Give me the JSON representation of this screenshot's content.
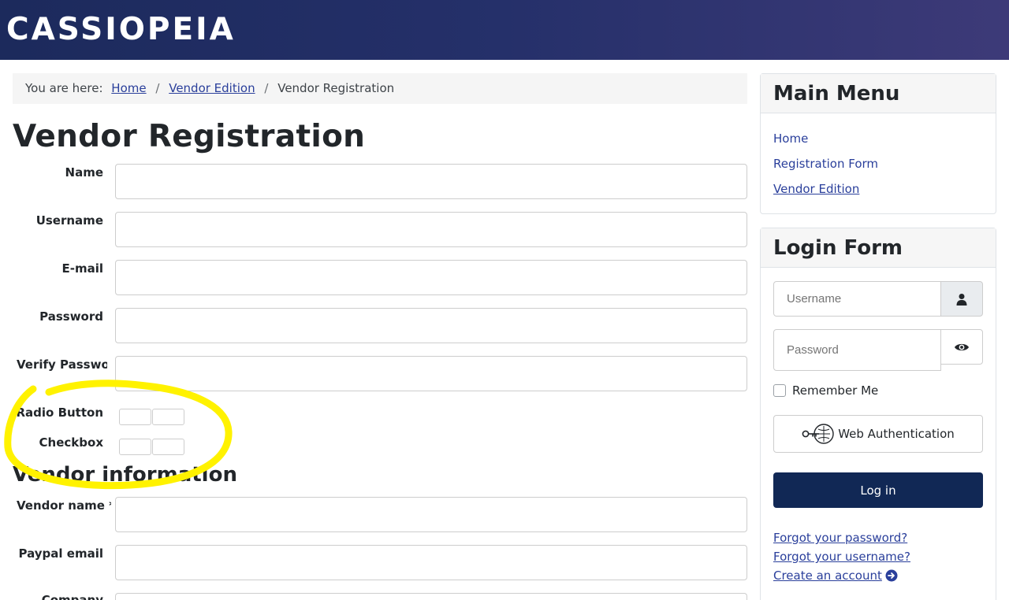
{
  "site": {
    "brand": "CASSIOPEIA"
  },
  "breadcrumb": {
    "prefix": "You are here:",
    "items": [
      "Home",
      "Vendor Edition",
      "Vendor Registration"
    ]
  },
  "page": {
    "title": "Vendor Registration"
  },
  "registration_form": {
    "fields": [
      {
        "label": "Name",
        "value": ""
      },
      {
        "label": "Username",
        "value": ""
      },
      {
        "label": "E-mail",
        "value": ""
      },
      {
        "label": "Password",
        "value": ""
      },
      {
        "label": "Verify Password",
        "value": ""
      }
    ],
    "radio_label": "Radio Button",
    "checkbox_label": "Checkbox"
  },
  "vendor_section": {
    "title": "Vendor information",
    "fields": [
      {
        "label": "Vendor name *.",
        "value": ""
      },
      {
        "label": "Paypal email",
        "value": ""
      },
      {
        "label": "Company",
        "value": ""
      }
    ]
  },
  "main_menu": {
    "title": "Main Menu",
    "items": [
      "Home",
      "Registration Form",
      "Vendor Edition"
    ],
    "active_item": "Vendor Edition"
  },
  "login_form": {
    "title": "Login Form",
    "username_placeholder": "Username",
    "password_placeholder": "Password",
    "remember_label": "Remember Me",
    "webauthn_label": "Web Authentication",
    "login_button": "Log in",
    "forgot_password": "Forgot your password?",
    "forgot_username": "Forgot your username?",
    "create_account": "Create an account"
  },
  "colors": {
    "header_start": "#1c2a5c",
    "header_end": "#3d3a78",
    "link": "#2a3f9b",
    "primary_button": "#112855",
    "annotation_highlight": "#fff200"
  },
  "icons": {
    "username_addon": "user-icon",
    "password_addon": "eye-icon",
    "webauthn": "webauthn-key-icon",
    "create_account": "arrow-circle-right-icon"
  }
}
